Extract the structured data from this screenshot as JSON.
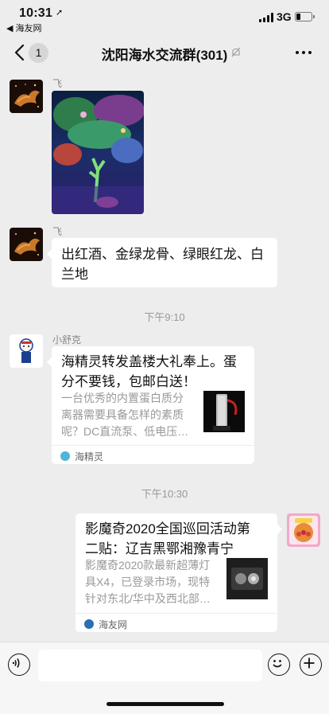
{
  "status_bar": {
    "time": "10:31",
    "back_app": "◀ 海友网",
    "network": "3G"
  },
  "nav": {
    "back_count": "1",
    "title": "沈阳海水交流群(301)"
  },
  "messages": [
    {
      "sender": "飞",
      "type": "image",
      "image_label": "coral tank photo"
    },
    {
      "sender": "飞",
      "type": "text",
      "text_lines": [
        "出红酒、金绿龙骨、绿眼红龙、白",
        "兰地"
      ]
    },
    {
      "type": "timestamp",
      "text": "下午9:10"
    },
    {
      "sender": "小舒克",
      "type": "link_card",
      "title_lines": [
        "海精灵转发盖楼大礼奉上。蛋",
        "分不要钱，包邮白送！"
      ],
      "desc_lines": [
        "一台优秀的内置蛋白质分",
        "离器需要具备怎样的素质",
        "呢？DC直流泵、低电压…"
      ],
      "source": "海精灵"
    },
    {
      "type": "timestamp",
      "text": "下午10:30"
    },
    {
      "type": "link_card",
      "self": true,
      "title_lines": [
        "影魔奇2020全国巡回活动第",
        "二贴：辽吉黑鄂湘豫青宁"
      ],
      "desc_lines": [
        "影魔奇2020款最新超薄灯",
        "具X4，已登录市场，现特",
        "针对东北/华中及西北部…"
      ],
      "source": "海友网"
    }
  ],
  "input": {
    "placeholder": ""
  },
  "colors": {
    "background": "#ededed",
    "bubble": "#ffffff",
    "meta_text": "#999999"
  }
}
